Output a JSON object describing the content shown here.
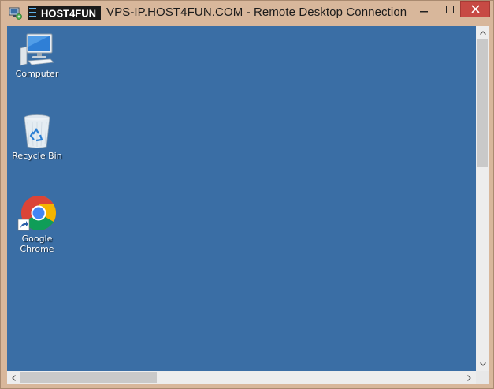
{
  "window": {
    "logo_text": "HOST4FUN",
    "title": "VPS-IP.HOST4FUN.COM - Remote Desktop Connection",
    "controls": [
      "minimize",
      "maximize",
      "close"
    ]
  },
  "desktop": {
    "background_color": "#3a6ea5",
    "icons": [
      {
        "label": "Computer",
        "icon": "computer-icon"
      },
      {
        "label": "Recycle Bin",
        "icon": "recycle-bin-icon"
      },
      {
        "label": "Google\nChrome",
        "icon": "chrome-icon"
      }
    ]
  },
  "colors": {
    "window_frame": "#d8b79b",
    "close_button": "#c74a44"
  }
}
